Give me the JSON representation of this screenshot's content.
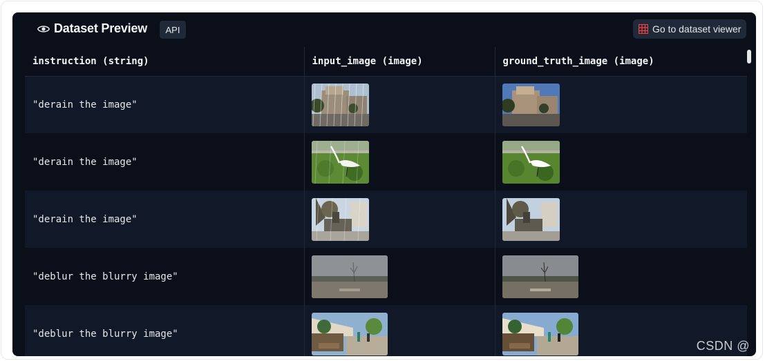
{
  "header": {
    "title": "Dataset Preview",
    "api_label": "API",
    "viewer_button": "Go to dataset viewer"
  },
  "table": {
    "columns": [
      "instruction (string)",
      "input_image (image)",
      "ground_truth_image (image)"
    ],
    "rows": [
      {
        "instruction": "\"derain the image\"",
        "input_scene": "rainy-plaza-buildings",
        "gt_scene": "plaza-buildings"
      },
      {
        "instruction": "\"derain the image\"",
        "input_scene": "egret-on-grass-rainy",
        "gt_scene": "egret-on-grass"
      },
      {
        "instruction": "\"derain the image\"",
        "input_scene": "fountain-statue-rainy",
        "gt_scene": "fountain-statue"
      },
      {
        "instruction": "\"deblur the blurry image\"",
        "input_scene": "overcast-park-blurry",
        "gt_scene": "overcast-park"
      },
      {
        "instruction": "\"deblur the blurry image\"",
        "input_scene": "street-market-blurry",
        "gt_scene": "street-market"
      }
    ]
  },
  "watermark": "CSDN @",
  "colors": {
    "panel_bg": "#0b0f19",
    "row_alt_bg": "#111827",
    "border": "#1f2937",
    "text": "#e5e7eb",
    "grid_icon": "#ef4444"
  }
}
